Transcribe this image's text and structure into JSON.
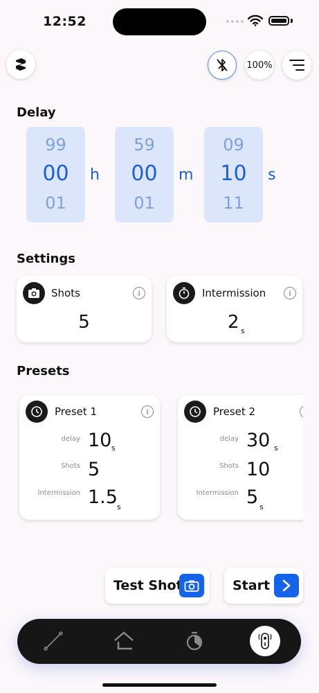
{
  "status_bar": {
    "time": "12:52"
  },
  "header": {
    "battery_percent_label": "100%"
  },
  "delay": {
    "title": "Delay",
    "hours": {
      "prev": "99",
      "value": "00",
      "next": "01",
      "unit": "h"
    },
    "minutes": {
      "prev": "59",
      "value": "00",
      "next": "01",
      "unit": "m"
    },
    "seconds": {
      "prev": "09",
      "value": "10",
      "next": "11",
      "unit": "s"
    }
  },
  "settings": {
    "title": "Settings",
    "shots": {
      "label": "Shots",
      "value": "5",
      "info": "i"
    },
    "intermission": {
      "label": "Intermission",
      "value": "2",
      "unit": "s",
      "info": "i"
    }
  },
  "presets": {
    "title": "Presets",
    "items": [
      {
        "name": "Preset 1",
        "info": "i",
        "delay_label": "delay",
        "delay": "10",
        "delay_unit": "s",
        "shots_label": "Shots",
        "shots": "5",
        "intermission_label": "Intermission",
        "intermission": "1.5",
        "intermission_unit": "s"
      },
      {
        "name": "Preset 2",
        "info": "i",
        "delay_label": "delay",
        "delay": "30",
        "delay_unit": "s",
        "shots_label": "Shots",
        "shots": "10",
        "intermission_label": "Intermission",
        "intermission": "5",
        "intermission_unit": "s"
      }
    ]
  },
  "actions": {
    "test_shot": "Test Shot",
    "start": "Start"
  },
  "colors": {
    "accent": "#1463e8",
    "picker_bg": "#dbe6fa",
    "nav_bg": "#161616"
  },
  "nav": {
    "items": [
      "line-icon",
      "home-icon",
      "timer-icon",
      "remote-icon"
    ],
    "active": "remote-icon"
  }
}
